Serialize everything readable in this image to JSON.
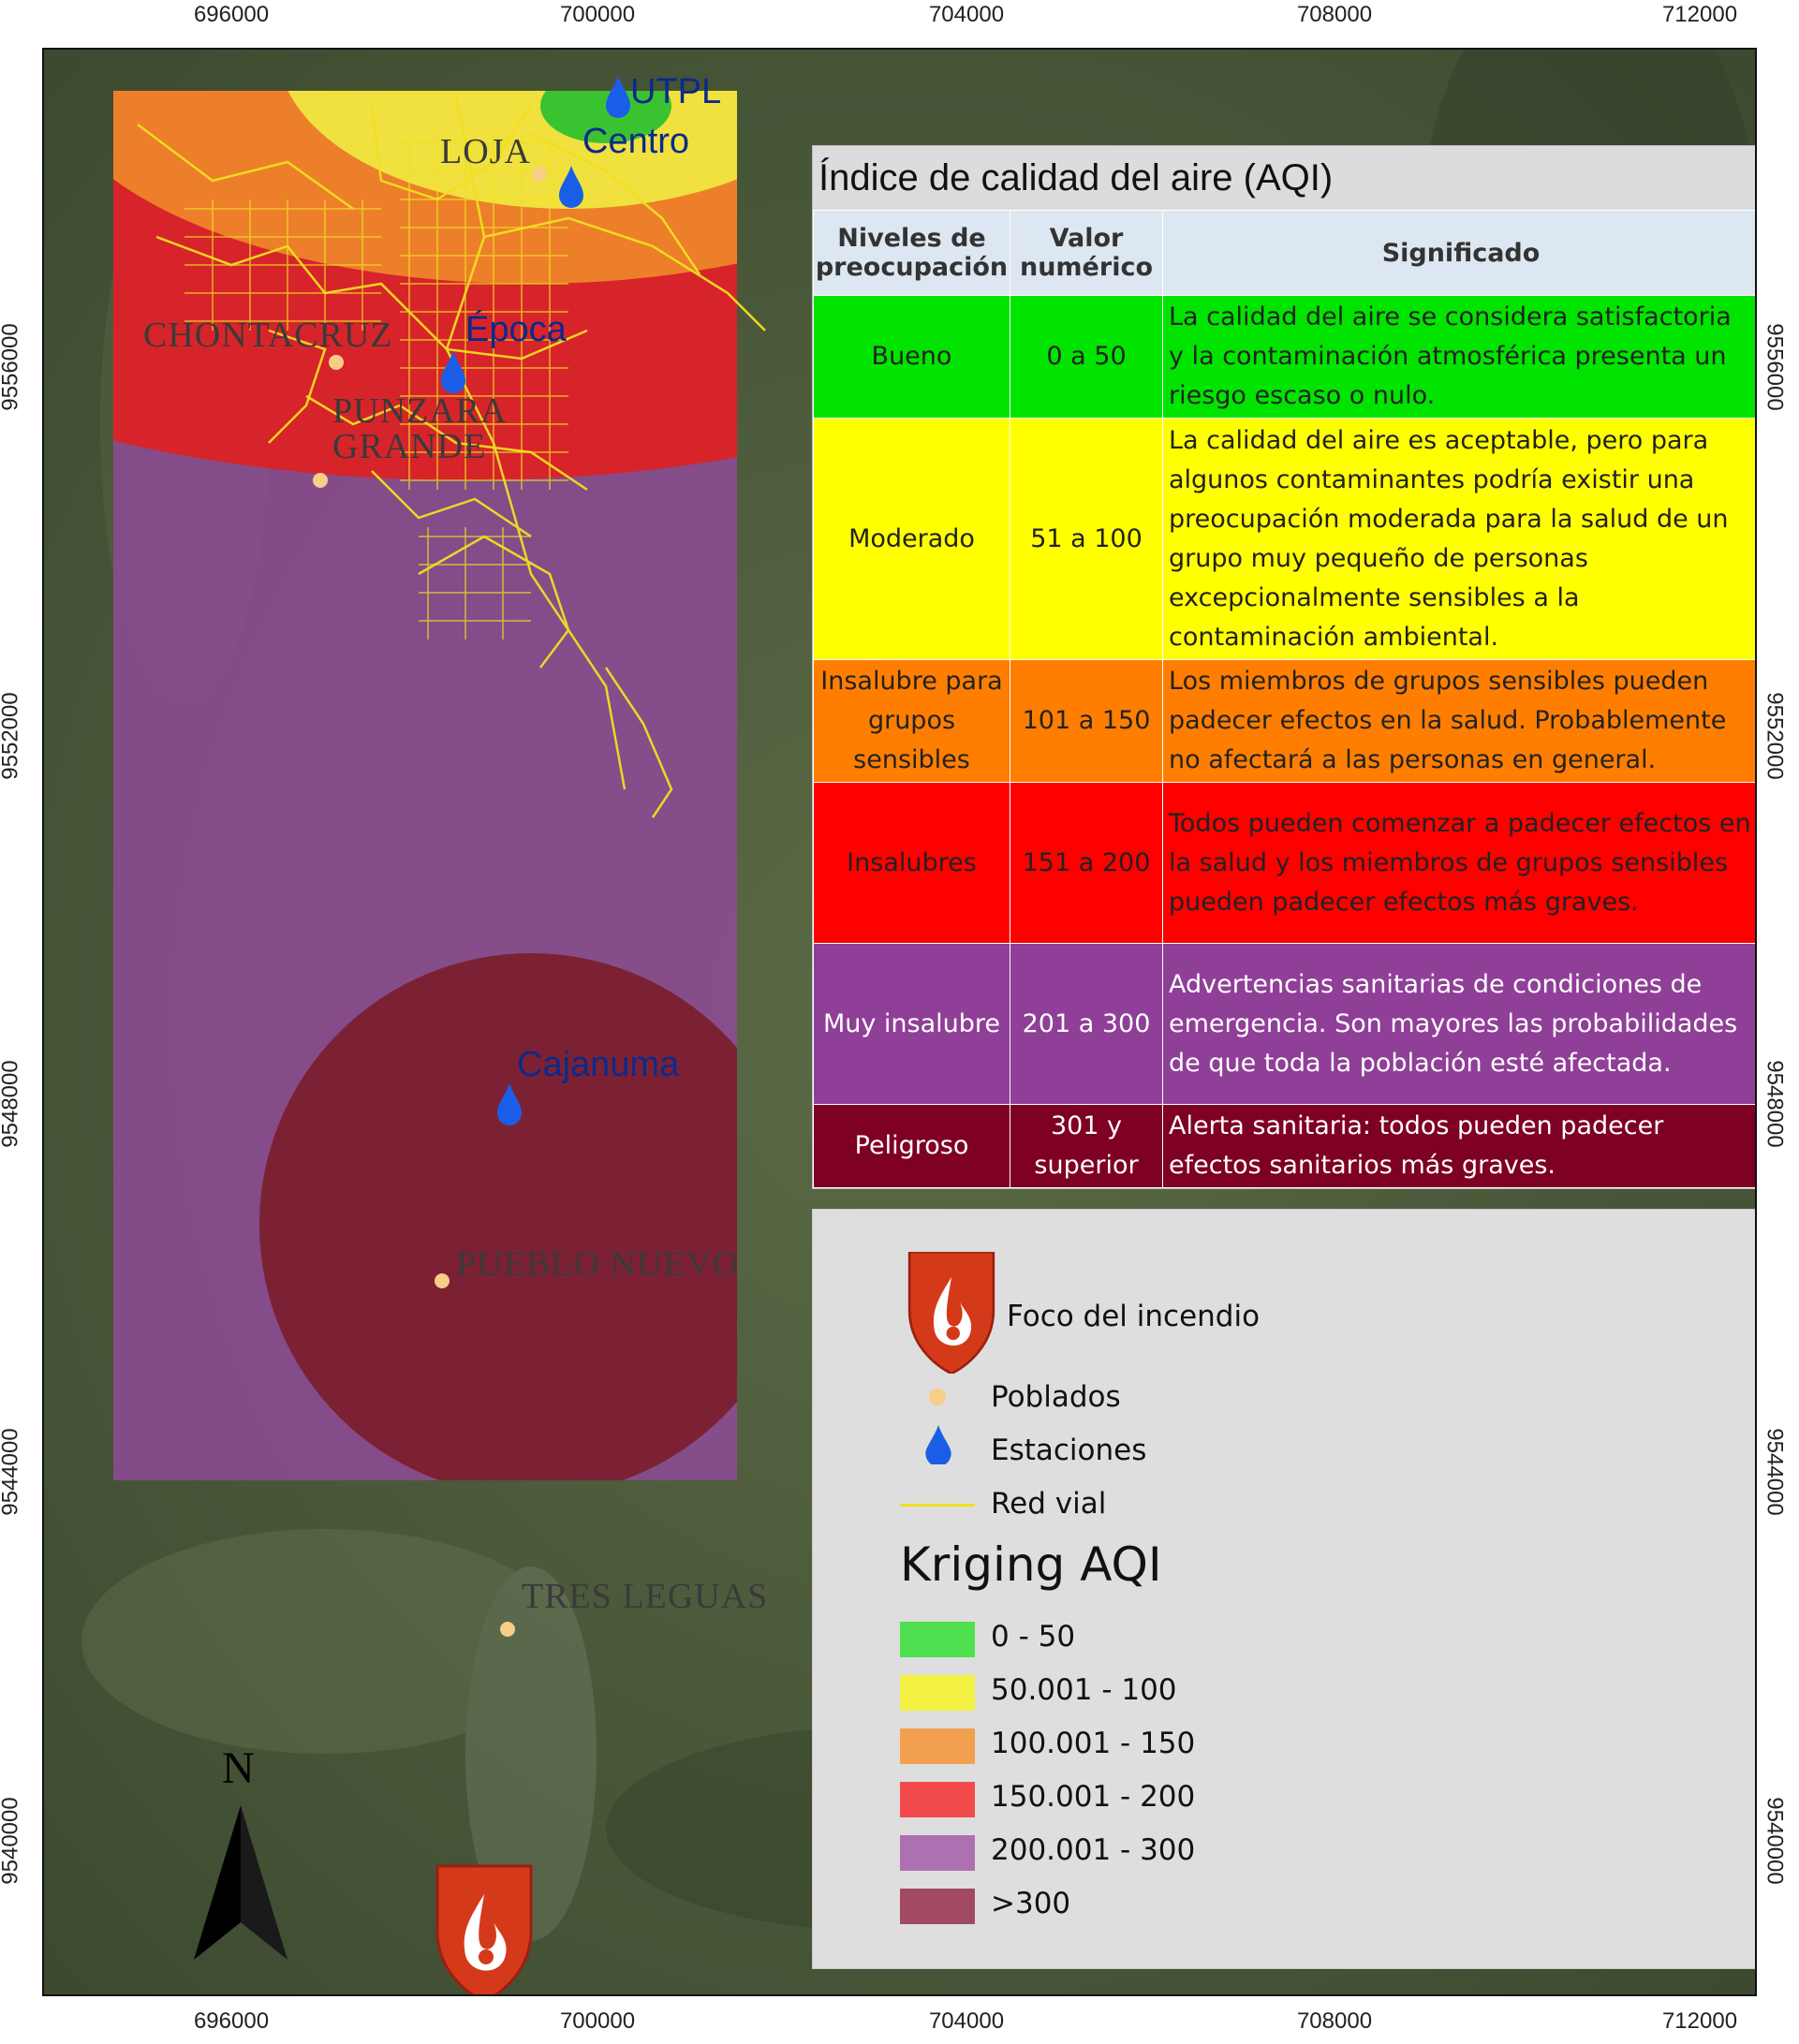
{
  "axes": {
    "x_ticks": [
      "696000",
      "700000",
      "704000",
      "708000",
      "712000"
    ],
    "y_ticks": [
      "9556000",
      "9552000",
      "9548000",
      "9544000",
      "9540000"
    ]
  },
  "map": {
    "places": [
      "LOJA",
      "CHONTACRUZ",
      "PUNZARA GRANDE",
      "PUEBLO NUEVO",
      "TRES LEGUAS"
    ],
    "stations": [
      "UTPL",
      "Centro",
      "Época",
      "Cajanuma"
    ],
    "north_label": "N",
    "icons": [
      "north-arrow-icon",
      "fire-shield-icon",
      "water-drop-icon"
    ]
  },
  "aqi_table": {
    "title": "Índice de calidad del aire (AQI)",
    "headers": [
      "Niveles de preocupación",
      "Valor numérico",
      "Significado"
    ],
    "rows": [
      {
        "level": "Bueno",
        "value": "0 a 50",
        "meaning": "La calidad del aire se considera satisfactoria y la contaminación atmosférica presenta un riesgo escaso o nulo.",
        "color": "#00e400"
      },
      {
        "level": "Moderado",
        "value": "51 a 100",
        "meaning": "La calidad del aire es aceptable, pero para algunos contaminantes podría existir una preocupación moderada para la salud de un grupo muy pequeño de personas excepcionalmente sensibles a la contaminación ambiental.",
        "color": "#ffff00"
      },
      {
        "level": "Insalubre para grupos sensibles",
        "value": "101 a 150",
        "meaning": "Los miembros de grupos sensibles pueden padecer efectos en la salud. Probablemente no afectará a las personas en general.",
        "color": "#ff7e00"
      },
      {
        "level": "Insalubres",
        "value": "151 a 200",
        "meaning": "Todos pueden comenzar a padecer efectos en la salud y los miembros de grupos sensibles pueden padecer efectos más graves.",
        "color": "#ff0000"
      },
      {
        "level": "Muy insalubre",
        "value": "201 a 300",
        "meaning": "Advertencias sanitarias de condiciones de emergencia. Son mayores las probabilidades de que toda la población esté afectada.",
        "color": "#8f3f97"
      },
      {
        "level": "Peligroso",
        "value": "301 y superior",
        "meaning": "Alerta sanitaria: todos pueden padecer efectos sanitarios más graves.",
        "color": "#7e0023"
      }
    ]
  },
  "legend": {
    "fire": "Foco del incendio",
    "towns": "Poblados",
    "stations": "Estaciones",
    "roads": "Red vial",
    "kriging_title": "Kriging AQI",
    "classes": [
      {
        "label": "0 - 50",
        "color": "#4fe04f"
      },
      {
        "label": "50.001 - 100",
        "color": "#f2f040"
      },
      {
        "label": "100.001 - 150",
        "color": "#f2a04f"
      },
      {
        "label": "150.001 - 200",
        "color": "#f24a4a"
      },
      {
        "label": "200.001 - 300",
        "color": "#ad70b0"
      },
      {
        "label": ">300",
        "color": "#a24a64"
      }
    ]
  }
}
